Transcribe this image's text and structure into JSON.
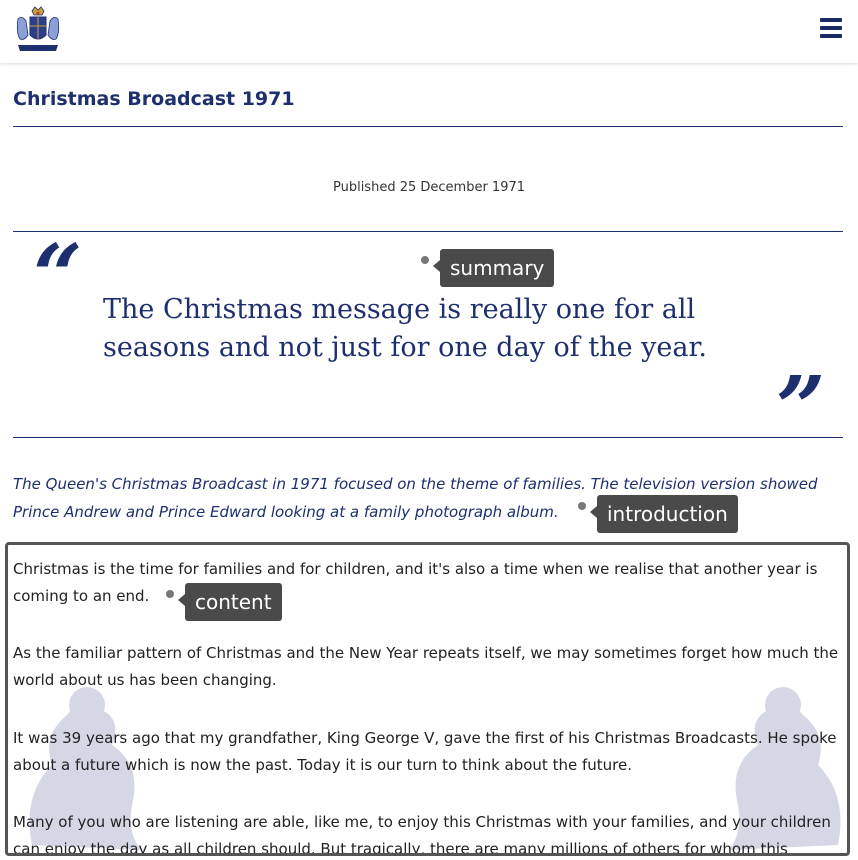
{
  "header": {
    "crest_icon": "royal-crest-icon",
    "menu_icon": "hamburger-menu-icon"
  },
  "page": {
    "title": "Christmas Broadcast 1971",
    "published": "Published 25 December 1971"
  },
  "quote": {
    "open_mark": "“",
    "text": "The Christmas message is really one for all seasons and not just for one day of the year.",
    "close_mark": "”"
  },
  "intro": "The Queen's Christmas Broadcast in 1971 focused on the theme of families. The television version showed Prince Andrew and Prince Edward looking at a family photograph album.",
  "content": {
    "paragraphs": [
      "Christmas is the time for families and for children, and it's also a time when we realise that another year is coming to an end.",
      "As the familiar pattern of Christmas and the New Year repeats itself, we may sometimes forget how much the world about us has been changing.",
      "It was 39 years ago that my grandfather, King George V, gave the first of his Christmas Broadcasts. He spoke about a future which is now the past. Today it is our turn to think about the future.",
      "Many of you who are listening are able, like me, to enjoy this Christmas with your families, and your children can enjoy the day as all children should. But tragically, there are many millions of others for whom this"
    ]
  },
  "tags": {
    "summary": "summary",
    "introduction": "introduction",
    "content": "content"
  },
  "colors": {
    "brand": "#1d2f6e",
    "tag_bg": "#4a4a4a"
  }
}
